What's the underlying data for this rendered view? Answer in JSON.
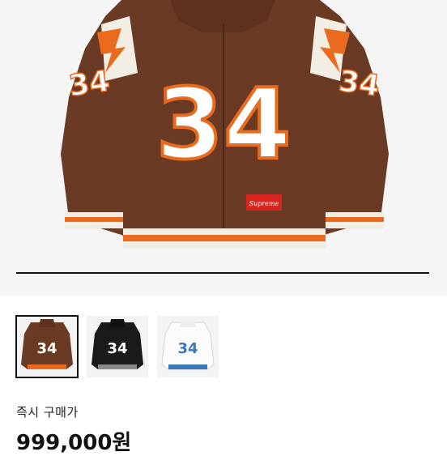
{
  "product": {
    "jersey_number": "34",
    "brand_patch": "Supreme",
    "colors": {
      "body": "#6b3a24",
      "accent": "#ea6a1e",
      "trim": "#f2eee4"
    }
  },
  "thumbnails": [
    {
      "number": "34",
      "body_color": "#6b3a24",
      "number_color": "#ffffff",
      "selected": true
    },
    {
      "number": "34",
      "body_color": "#1a1a1a",
      "number_color": "#ffffff",
      "selected": false
    },
    {
      "number": "34",
      "body_color": "#f7f7f7",
      "number_color": "#3a78b8",
      "selected": false
    }
  ],
  "purchase": {
    "label": "즉시 구매가",
    "price": "999,000원"
  }
}
